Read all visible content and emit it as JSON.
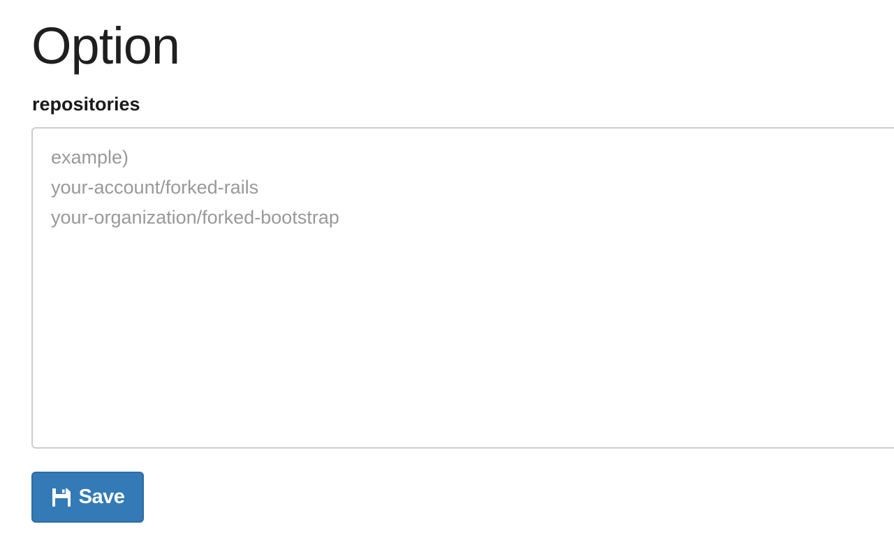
{
  "page": {
    "title": "Option"
  },
  "form": {
    "repositories_label": "repositories",
    "repositories_placeholder": "example)\nyour-account/forked-rails\nyour-organization/forked-bootstrap",
    "repositories_value": ""
  },
  "actions": {
    "save_label": "Save",
    "save_icon": "floppy-disk-icon"
  },
  "colors": {
    "primary": "#337ab7",
    "primary_border": "#2e6da4",
    "placeholder": "#999999",
    "input_border": "#cccccc"
  }
}
